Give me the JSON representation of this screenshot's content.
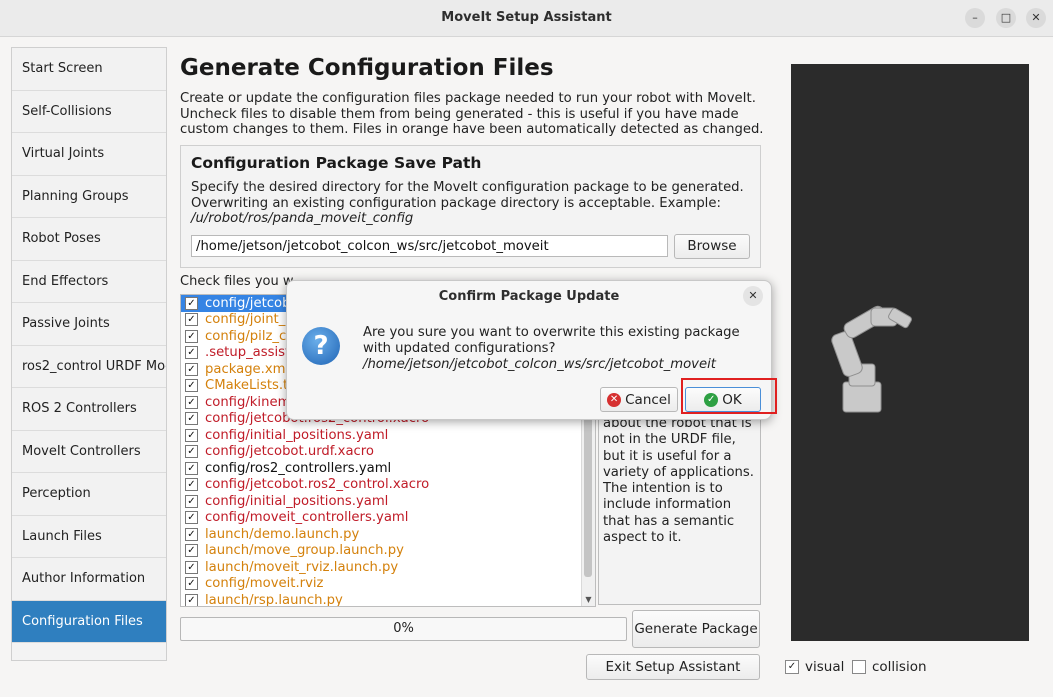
{
  "window": {
    "title": "MoveIt Setup Assistant"
  },
  "sidebar": {
    "items": [
      {
        "label": "Start Screen"
      },
      {
        "label": "Self-Collisions"
      },
      {
        "label": "Virtual Joints"
      },
      {
        "label": "Planning Groups"
      },
      {
        "label": "Robot Poses"
      },
      {
        "label": "End Effectors"
      },
      {
        "label": "Passive Joints"
      },
      {
        "label": "ros2_control URDF Mod"
      },
      {
        "label": "ROS 2 Controllers"
      },
      {
        "label": "MoveIt Controllers"
      },
      {
        "label": "Perception"
      },
      {
        "label": "Launch Files"
      },
      {
        "label": "Author Information"
      },
      {
        "label": "Configuration Files"
      }
    ],
    "active_index": 13
  },
  "main": {
    "heading": "Generate Configuration Files",
    "description": "Create or update the configuration files package needed to run your robot with MoveIt. Uncheck files to disable them from being generated - this is useful if you have made custom changes to them. Files in orange have been automatically detected as changed.",
    "save_path": {
      "title": "Configuration Package Save Path",
      "description": "Specify the desired directory for the MoveIt configuration package to be generated. Overwriting an existing configuration package directory is acceptable. Example: ",
      "example": "/u/robot/ros/panda_moveit_config",
      "value": "/home/jetson/jetcobot_colcon_ws/src/jetcobot_moveit",
      "browse_label": "Browse"
    },
    "check_label": "Check files you w",
    "files": [
      {
        "name": "config/jetcob",
        "color": "orange",
        "checked": true,
        "selected": true
      },
      {
        "name": "config/joint_",
        "color": "orange",
        "checked": true
      },
      {
        "name": "config/pilz_c",
        "color": "orange",
        "checked": true
      },
      {
        "name": ".setup_assist",
        "color": "red",
        "checked": true
      },
      {
        "name": "package.xml",
        "color": "orange",
        "checked": true
      },
      {
        "name": "CMakeLists.t",
        "color": "orange",
        "checked": true
      },
      {
        "name": "config/kinem",
        "color": "red",
        "checked": true
      },
      {
        "name": "config/jetcobot.ros2_control.xacro",
        "color": "red",
        "checked": true
      },
      {
        "name": "config/initial_positions.yaml",
        "color": "red",
        "checked": true
      },
      {
        "name": "config/jetcobot.urdf.xacro",
        "color": "red",
        "checked": true
      },
      {
        "name": "config/ros2_controllers.yaml",
        "color": "black",
        "checked": true
      },
      {
        "name": "config/jetcobot.ros2_control.xacro",
        "color": "red",
        "checked": true
      },
      {
        "name": "config/initial_positions.yaml",
        "color": "red",
        "checked": true
      },
      {
        "name": "config/moveit_controllers.yaml",
        "color": "red",
        "checked": true
      },
      {
        "name": "launch/demo.launch.py",
        "color": "orange",
        "checked": true
      },
      {
        "name": "launch/move_group.launch.py",
        "color": "orange",
        "checked": true
      },
      {
        "name": "launch/moveit_rviz.launch.py",
        "color": "orange",
        "checked": true
      },
      {
        "name": "config/moveit.rviz",
        "color": "orange",
        "checked": true
      },
      {
        "name": "launch/rsp.launch.py",
        "color": "orange",
        "checked": true
      }
    ],
    "file_description": "about the robot that is not in the URDF file, but it is useful for a variety of applications. The intention is to include information that has a semantic aspect to it.",
    "progress": {
      "text": "0%",
      "value": 0
    },
    "generate_label": "Generate Package",
    "exit_label": "Exit Setup Assistant"
  },
  "viewer": {
    "visual_label": "visual",
    "visual_checked": true,
    "collision_label": "collision",
    "collision_checked": false
  },
  "dialog": {
    "title": "Confirm Package Update",
    "message": "Are you sure you want to overwrite this existing package with updated configurations?",
    "path": "/home/jetson/jetcobot_colcon_ws/src/jetcobot_moveit",
    "cancel_label": "Cancel",
    "ok_label": "OK"
  },
  "colors": {
    "accent": "#2f7fbf",
    "red_file": "#c01c28",
    "orange_file": "#d4810c",
    "highlight": "#e02020"
  }
}
